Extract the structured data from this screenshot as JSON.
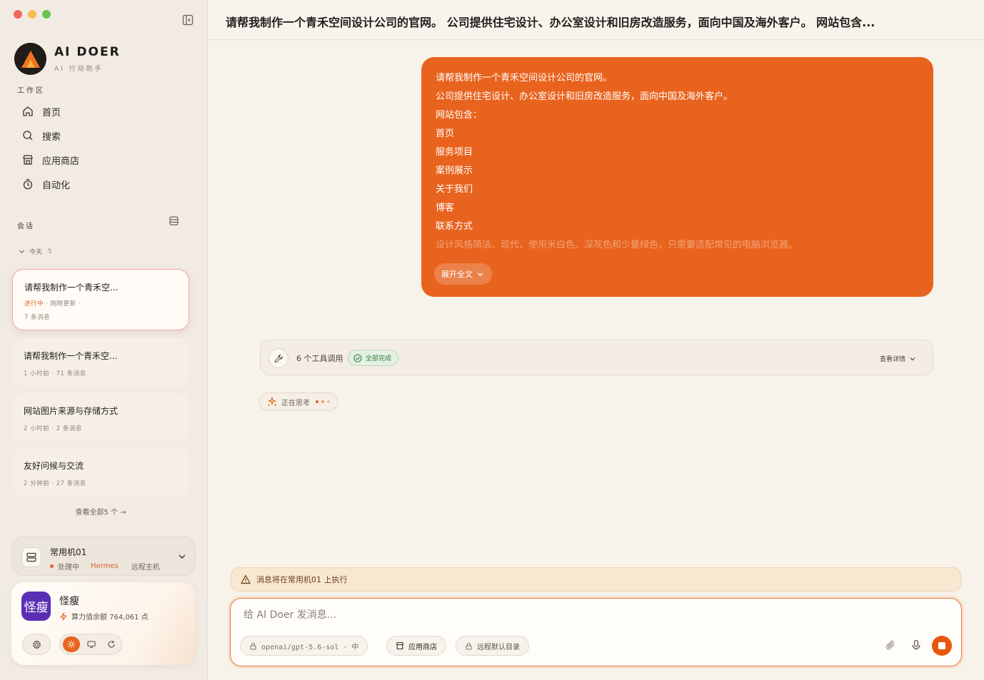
{
  "colors": {
    "accent": "#e8631e",
    "close": "#ee6a5f",
    "minimize": "#f5be4f",
    "maximize": "#62c555",
    "success": "#37803f",
    "avatar": "#5b2fb5"
  },
  "brand": {
    "name": "AI DOER",
    "subtitle": "AI 行动助手"
  },
  "sidebar": {
    "workspace_label": "工作区",
    "nav": [
      {
        "label": "首页",
        "icon": "home-icon"
      },
      {
        "label": "搜索",
        "icon": "search-icon"
      },
      {
        "label": "应用商店",
        "icon": "store-icon"
      },
      {
        "label": "自动化",
        "icon": "timer-icon"
      }
    ],
    "conversations_label": "会话",
    "today_label": "今天",
    "today_count": "5",
    "conversations": [
      {
        "title": "请帮我制作一个青禾空...",
        "status": "进行中",
        "updated": "刚刚更新",
        "messages": "7 条消息",
        "active": true
      },
      {
        "title": "请帮我制作一个青禾空...",
        "meta": "1 小时前 · 71 条消息"
      },
      {
        "title": "网站图片来源与存储方式",
        "meta": "2 小时前 · 2 条消息"
      },
      {
        "title": "友好问候与交流",
        "meta": "2 分钟前 · 27 条消息"
      }
    ],
    "view_all": "查看全部5 个 →",
    "machine": {
      "name": "常用机01",
      "status": "处理中",
      "agent": "Hermes",
      "type": "远程主机"
    },
    "user": {
      "avatar_text": "怪瘦",
      "name": "怪瘦",
      "credits": "算力值余额 764,061 点"
    }
  },
  "main": {
    "title": "请帮我制作一个青禾空间设计公司的官网。 公司提供住宅设计、办公室设计和旧房改造服务，面向中国及海外客户。 网站包含...",
    "message_lines": [
      "请帮我制作一个青禾空间设计公司的官网。",
      "公司提供住宅设计、办公室设计和旧房改造服务，面向中国及海外客户。",
      "网站包含：",
      "首页",
      "服务项目",
      "案例展示",
      "关于我们",
      "博客",
      "联系方式",
      "设计风格简洁、现代，使用米白色、深灰色和少量绿色，只需要适配常见的电脑浏览器。"
    ],
    "expand_label": "展开全文",
    "tools": {
      "count_label": "6 个工具调用",
      "status": "全部完成",
      "details": "查看详情"
    },
    "thinking_label": "正在思考",
    "warning": "消息将在常用机01 上执行",
    "composer": {
      "placeholder": "给 AI Doer 发消息...",
      "model_chip": "openai/gpt-5.6-sol · 中",
      "store_chip": "应用商店",
      "dir_chip": "远程默认目录"
    }
  }
}
